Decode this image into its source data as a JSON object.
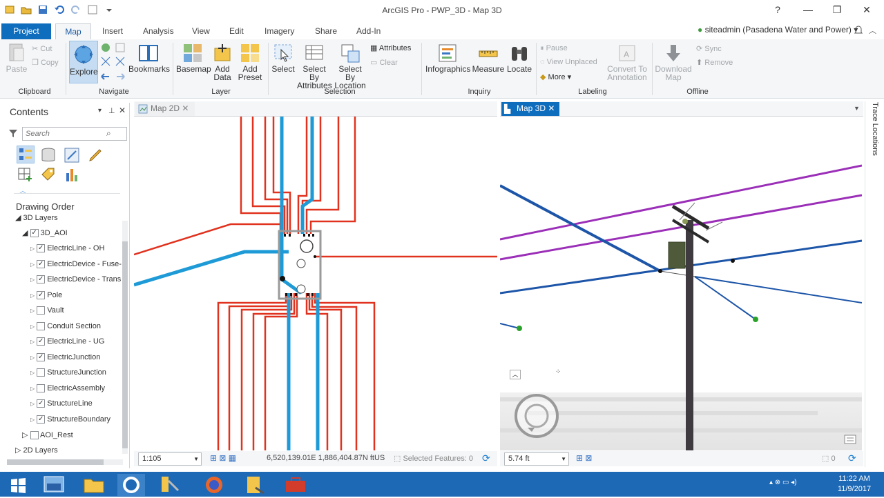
{
  "window": {
    "title": "ArcGIS Pro - PWP_3D - Map 3D",
    "help": "?",
    "minimize": "—",
    "restore": "❐",
    "close": "✕"
  },
  "tabs": [
    "Project",
    "Map",
    "Insert",
    "Analysis",
    "View",
    "Edit",
    "Imagery",
    "Share",
    "Add-In"
  ],
  "user": {
    "name": "siteadmin (Pasadena Water and Power)"
  },
  "ribbon": {
    "clipboard": {
      "paste": "Paste",
      "cut": "Cut",
      "copy": "Copy",
      "label": "Clipboard"
    },
    "navigate": {
      "explore": "Explore",
      "bookmarks": "Bookmarks",
      "label": "Navigate"
    },
    "layer": {
      "basemap": "Basemap",
      "add_data_1": "Add",
      "add_data_2": "Data",
      "add_preset_1": "Add",
      "add_preset_2": "Preset",
      "label": "Layer"
    },
    "selection": {
      "select": "Select",
      "sba_1": "Select By",
      "sba_2": "Attributes",
      "sbl_1": "Select By",
      "sbl_2": "Location",
      "attributes": "Attributes",
      "clear": "Clear",
      "label": "Selection"
    },
    "inquiry": {
      "infographics": "Infographics",
      "measure": "Measure",
      "locate": "Locate",
      "label": "Inquiry"
    },
    "labeling": {
      "pause": "Pause",
      "view_unplaced": "View Unplaced",
      "more": "More",
      "convert_1": "Convert To",
      "convert_2": "Annotation",
      "label": "Labeling"
    },
    "offline": {
      "download_1": "Download",
      "download_2": "Map",
      "sync": "Sync",
      "remove": "Remove",
      "label": "Offline"
    }
  },
  "contents": {
    "title": "Contents",
    "search_placeholder": "Search",
    "drawing_order": "Drawing Order",
    "group_3d": "3D Layers",
    "aoi": "3D_AOI",
    "layers": [
      {
        "name": "ElectricLine - OH",
        "checked": true
      },
      {
        "name": "ElectricDevice - Fuse-",
        "checked": true
      },
      {
        "name": "ElectricDevice - Trans",
        "checked": true
      },
      {
        "name": "Pole",
        "checked": true
      },
      {
        "name": "Vault",
        "checked": false
      },
      {
        "name": "Conduit Section",
        "checked": false
      },
      {
        "name": "ElectricLine - UG",
        "checked": true
      },
      {
        "name": "ElectricJunction",
        "checked": true
      },
      {
        "name": "StructureJunction",
        "checked": false
      },
      {
        "name": "ElectricAssembly",
        "checked": false
      },
      {
        "name": "StructureLine",
        "checked": true
      },
      {
        "name": "StructureBoundary",
        "checked": true
      }
    ],
    "aoi_rest": "AOI_Rest",
    "group_2d": "2D Layers"
  },
  "map2d": {
    "tab": "Map 2D",
    "scale": "1:105",
    "coords": "6,520,139.01E 1,886,404.87N ftUS",
    "selected": "Selected Features: 0"
  },
  "map3d": {
    "tab": "Map 3D",
    "scale": "5.74 ft",
    "selected_count": "0"
  },
  "side_pane": {
    "label": "Trace Locations"
  },
  "taskbar": {
    "time": "11:22 AM",
    "date": "11/9/2017"
  },
  "colors": {
    "accent": "#0f6dbd",
    "electric_red": "#e0321e",
    "water_blue": "#1e9bd7",
    "line_3d_blue": "#1d55a8",
    "line_3d_purple": "#9b2fb8"
  }
}
